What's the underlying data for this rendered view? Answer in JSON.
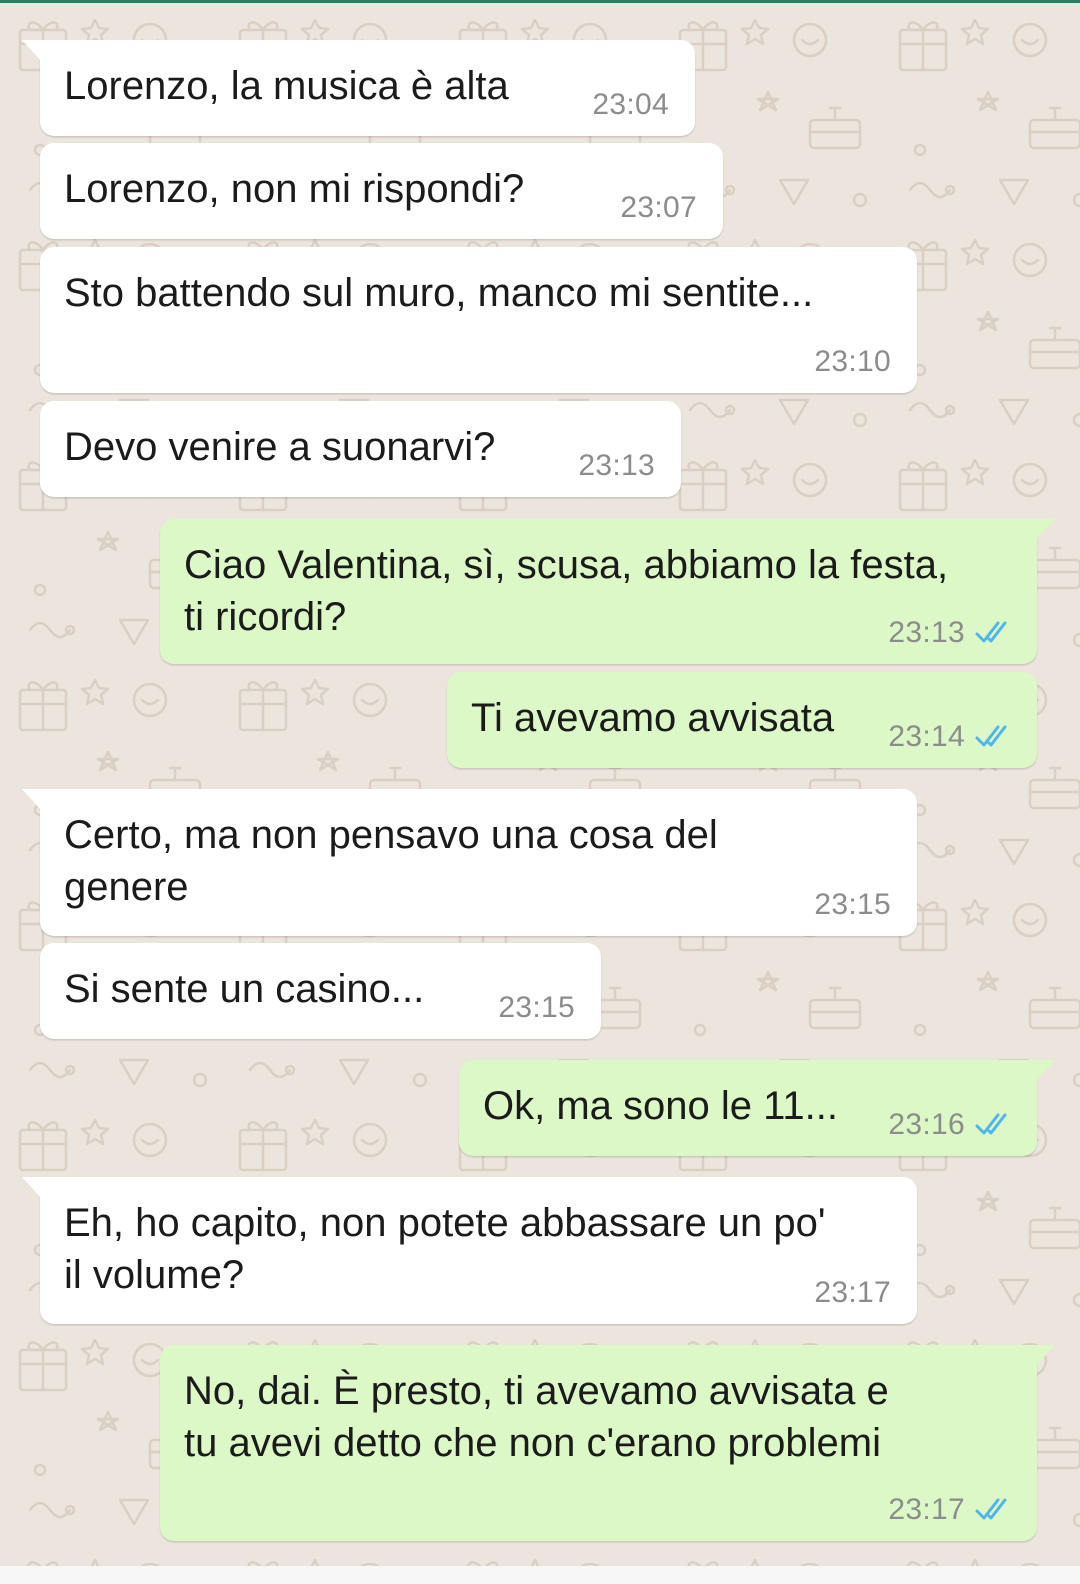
{
  "colors": {
    "wallpaper": "#ece5dd",
    "incoming_bubble": "#ffffff",
    "outgoing_bubble": "#dcf8c6",
    "read_ticks": "#4fb6ec",
    "time_text": "#8c8c8c"
  },
  "icons": {
    "read_receipt": "double-check-icon"
  },
  "messages": [
    {
      "direction": "in",
      "text": "Lorenzo, la musica è alta",
      "time": "23:04"
    },
    {
      "direction": "in",
      "text": "Lorenzo, non mi rispondi?",
      "time": "23:07"
    },
    {
      "direction": "in",
      "text": "Sto battendo sul muro, manco mi sentite...",
      "time": "23:10"
    },
    {
      "direction": "in",
      "text": "Devo venire a suonarvi?",
      "time": "23:13"
    },
    {
      "direction": "out",
      "text": "Ciao Valentina, sì, scusa, abbiamo la festa,\nti ricordi?",
      "time": "23:13",
      "status": "read"
    },
    {
      "direction": "out",
      "text": "Ti avevamo avvisata",
      "time": "23:14",
      "status": "read"
    },
    {
      "direction": "in",
      "text": "Certo, ma non pensavo una cosa del\ngenere",
      "time": "23:15"
    },
    {
      "direction": "in",
      "text": "Si sente un casino...",
      "time": "23:15"
    },
    {
      "direction": "out",
      "text": "Ok, ma sono le 11...",
      "time": "23:16",
      "status": "read"
    },
    {
      "direction": "in",
      "text": "Eh, ho capito, non potete abbassare un po'\nil volume?",
      "time": "23:17"
    },
    {
      "direction": "out",
      "text": "No, dai. È presto, ti avevamo avvisata e\ntu avevi detto che non c'erano problemi",
      "time": "23:17",
      "status": "read"
    }
  ]
}
